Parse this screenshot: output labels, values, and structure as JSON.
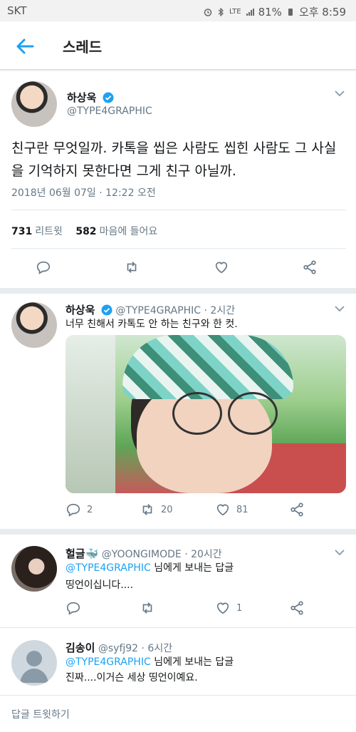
{
  "status_bar": {
    "carrier": "SKT",
    "network": "LTE",
    "battery": "81%",
    "time": "오후 8:59"
  },
  "header": {
    "title": "스레드"
  },
  "main_tweet": {
    "author_name": "하상욱",
    "author_handle": "@TYPE4GRAPHIC",
    "text": "친구란 무엇일까. 카톡을 씹은 사람도 씹힌 사람도 그 사실을 기억하지 못한다면 그게 친구 아닐까.",
    "timestamp": "2018년 06월 07일 · 12:22 오전",
    "retweet_count": "731",
    "retweet_label": "리트윗",
    "like_count": "582",
    "like_label": "마음에 들어요"
  },
  "replies": [
    {
      "author_name": "하상욱",
      "author_handle": "@TYPE4GRAPHIC",
      "time": "· 2시간",
      "text": "너무 친해서 카톡도 안 하는 친구와 한 컷.",
      "reply_count": "2",
      "retweet_count": "20",
      "like_count": "81"
    },
    {
      "author_name": "헐글🐳",
      "author_handle": "@YOONGIMODE",
      "time": "· 20시간",
      "mention": "@TYPE4GRAPHIC",
      "reply_to_label": "님에게 보내는 답글",
      "text": "띵언이십니다....",
      "like_count": "1"
    },
    {
      "author_name": "김송이",
      "author_handle": "@syfj92",
      "time": "· 6시간",
      "mention": "@TYPE4GRAPHIC",
      "reply_to_label": "님에게 보내는 답글",
      "text": "진짜....이거슨 세상 띵언이예요."
    }
  ],
  "reply_composer": {
    "placeholder": "답글 트윗하기"
  },
  "colors": {
    "accent": "#1da1f2",
    "secondary_text": "#657786",
    "divider": "#e1e8ed"
  }
}
